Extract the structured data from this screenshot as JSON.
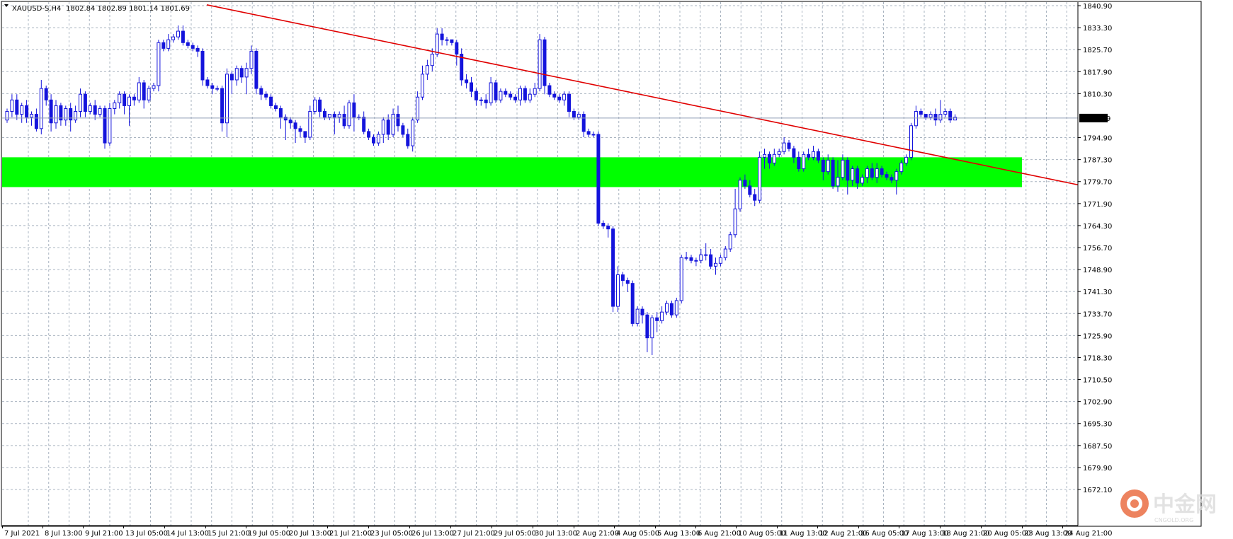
{
  "header": {
    "symbol": "XAUUSD-S,H4",
    "ohlc": "1802.84 1802.89 1801.14 1801.69"
  },
  "colors": {
    "background": "#ffffff",
    "grid": "#a9b4c0",
    "bull": "#1414dc",
    "bear": "#1414dc",
    "zone": "#00ff00",
    "trendline": "#e00000",
    "price_line": "#8f9cb4",
    "price_tag_bg": "#000000",
    "price_tag_text": "#ffffff"
  },
  "watermark": {
    "brand": "中金网",
    "sub": "CNGOLD.ORG"
  },
  "chart_data": {
    "type": "candlestick",
    "symbol": "XAUUSD-S",
    "timeframe": "H4",
    "current_price": 1801.69,
    "y_range": [
      1672.1,
      1840.9
    ],
    "y_ticks": [
      "1840.90",
      "1833.30",
      "1825.70",
      "1817.90",
      "1810.30",
      "1801.69",
      "1794.90",
      "1787.30",
      "1779.70",
      "1771.90",
      "1764.30",
      "1756.70",
      "1748.90",
      "1741.30",
      "1733.70",
      "1725.90",
      "1718.30",
      "1710.50",
      "1702.90",
      "1695.30",
      "1687.50",
      "1679.90",
      "1672.10"
    ],
    "x_ticks": [
      "7 Jul 2021",
      "8 Jul 13:00",
      "9 Jul 21:00",
      "13 Jul 05:00",
      "14 Jul 13:00",
      "15 Jul 21:00",
      "19 Jul 05:00",
      "20 Jul 13:00",
      "21 Jul 21:00",
      "23 Jul 05:00",
      "26 Jul 13:00",
      "27 Jul 21:00",
      "29 Jul 05:00",
      "30 Jul 13:00",
      "2 Aug 21:00",
      "4 Aug 05:00",
      "5 Aug 13:00",
      "6 Aug 21:00",
      "10 Aug 05:00",
      "11 Aug 13:00",
      "12 Aug 21:00",
      "16 Aug 05:00",
      "17 Aug 13:00",
      "18 Aug 21:00",
      "20 Aug 05:00",
      "23 Aug 13:00",
      "24 Aug 21:00"
    ],
    "support_zone": [
      1777.6,
      1788.0
    ],
    "trendline": {
      "from": [
        0,
        1841.2
      ],
      "to": [
        261,
        1778.4
      ]
    },
    "candles": [
      [
        1801,
        1804,
        1800,
        1805
      ],
      [
        1804,
        1808,
        1802,
        1810
      ],
      [
        1808,
        1803,
        1801,
        1810
      ],
      [
        1803,
        1806,
        1800,
        1807
      ],
      [
        1806,
        1802,
        1800,
        1808
      ],
      [
        1802,
        1803,
        1799,
        1804
      ],
      [
        1803,
        1798,
        1797,
        1805
      ],
      [
        1798,
        1812,
        1796,
        1815
      ],
      [
        1812,
        1808,
        1806,
        1813
      ],
      [
        1808,
        1800,
        1797,
        1810
      ],
      [
        1800,
        1806,
        1798,
        1808
      ],
      [
        1806,
        1801,
        1799,
        1807
      ],
      [
        1801,
        1805,
        1799,
        1806
      ],
      [
        1805,
        1801,
        1797,
        1807
      ],
      [
        1801,
        1804,
        1800,
        1806
      ],
      [
        1804,
        1810,
        1802,
        1812
      ],
      [
        1810,
        1804,
        1802,
        1811
      ],
      [
        1804,
        1806,
        1803,
        1807
      ],
      [
        1806,
        1803,
        1801,
        1808
      ],
      [
        1803,
        1805,
        1802,
        1806
      ],
      [
        1805,
        1793,
        1791,
        1806
      ],
      [
        1793,
        1805,
        1792,
        1807
      ],
      [
        1805,
        1807,
        1803,
        1808
      ],
      [
        1807,
        1810,
        1805,
        1811
      ],
      [
        1810,
        1806,
        1803,
        1811
      ],
      [
        1806,
        1809,
        1799,
        1810
      ],
      [
        1809,
        1808,
        1806,
        1810
      ],
      [
        1808,
        1814,
        1807,
        1816
      ],
      [
        1814,
        1808,
        1805,
        1815
      ],
      [
        1808,
        1812,
        1807,
        1813
      ],
      [
        1812,
        1813,
        1811,
        1814
      ],
      [
        1813,
        1828,
        1811,
        1829
      ],
      [
        1828,
        1826,
        1825,
        1829
      ],
      [
        1826,
        1829,
        1825,
        1831
      ],
      [
        1829,
        1830,
        1828,
        1831
      ],
      [
        1830,
        1832,
        1829,
        1834
      ],
      [
        1832,
        1828,
        1827,
        1834
      ],
      [
        1828,
        1827,
        1826,
        1829
      ],
      [
        1827,
        1826,
        1825,
        1828
      ],
      [
        1826,
        1825,
        1823,
        1827
      ],
      [
        1825,
        1815,
        1813,
        1826
      ],
      [
        1815,
        1813,
        1812,
        1816
      ],
      [
        1813,
        1812,
        1810,
        1814
      ],
      [
        1812,
        1812,
        1811,
        1813
      ],
      [
        1812,
        1800,
        1797,
        1813
      ],
      [
        1800,
        1817,
        1795,
        1819
      ],
      [
        1817,
        1815,
        1810,
        1818
      ],
      [
        1815,
        1819,
        1813,
        1820
      ],
      [
        1819,
        1816,
        1814,
        1820
      ],
      [
        1816,
        1819,
        1810,
        1821
      ],
      [
        1819,
        1825,
        1817,
        1827
      ],
      [
        1825,
        1812,
        1810,
        1826
      ],
      [
        1812,
        1810,
        1808,
        1813
      ],
      [
        1810,
        1809,
        1808,
        1811
      ],
      [
        1809,
        1806,
        1805,
        1810
      ],
      [
        1806,
        1805,
        1804,
        1807
      ],
      [
        1805,
        1802,
        1798,
        1806
      ],
      [
        1802,
        1801,
        1794,
        1803
      ],
      [
        1801,
        1800,
        1798,
        1802
      ],
      [
        1800,
        1798,
        1793,
        1801
      ],
      [
        1798,
        1797,
        1795,
        1799
      ],
      [
        1797,
        1795,
        1793,
        1797
      ],
      [
        1795,
        1804,
        1794,
        1806
      ],
      [
        1804,
        1808,
        1803,
        1809
      ],
      [
        1808,
        1804,
        1802,
        1809
      ],
      [
        1804,
        1802,
        1801,
        1805
      ],
      [
        1802,
        1803,
        1801,
        1803
      ],
      [
        1803,
        1802,
        1796,
        1804
      ],
      [
        1802,
        1803,
        1800,
        1804
      ],
      [
        1803,
        1799,
        1798,
        1806
      ],
      [
        1799,
        1807,
        1798,
        1808
      ],
      [
        1807,
        1802,
        1797,
        1810
      ],
      [
        1802,
        1802,
        1801,
        1803
      ],
      [
        1802,
        1797,
        1796,
        1804
      ],
      [
        1797,
        1795,
        1794,
        1798
      ],
      [
        1795,
        1793,
        1792,
        1796
      ],
      [
        1793,
        1796,
        1792,
        1797
      ],
      [
        1796,
        1801,
        1793,
        1802
      ],
      [
        1801,
        1796,
        1794,
        1803
      ],
      [
        1796,
        1803,
        1795,
        1805
      ],
      [
        1803,
        1799,
        1797,
        1806
      ],
      [
        1799,
        1796,
        1795,
        1800
      ],
      [
        1796,
        1792,
        1791,
        1798
      ],
      [
        1792,
        1801,
        1790,
        1802
      ],
      [
        1801,
        1809,
        1800,
        1811
      ],
      [
        1809,
        1817,
        1808,
        1820
      ],
      [
        1817,
        1820,
        1815,
        1822
      ],
      [
        1820,
        1824,
        1818,
        1826
      ],
      [
        1824,
        1831,
        1823,
        1833
      ],
      [
        1831,
        1829,
        1827,
        1833
      ],
      [
        1829,
        1829,
        1827,
        1830
      ],
      [
        1829,
        1828,
        1827,
        1829
      ],
      [
        1828,
        1824,
        1820,
        1829
      ],
      [
        1824,
        1815,
        1813,
        1826
      ],
      [
        1815,
        1814,
        1812,
        1817
      ],
      [
        1814,
        1811,
        1809,
        1816
      ],
      [
        1811,
        1808,
        1806,
        1812
      ],
      [
        1808,
        1808,
        1806,
        1809
      ],
      [
        1808,
        1807,
        1805,
        1810
      ],
      [
        1807,
        1814,
        1806,
        1816
      ],
      [
        1814,
        1808,
        1807,
        1815
      ],
      [
        1808,
        1811,
        1807,
        1812
      ],
      [
        1811,
        1810,
        1809,
        1812
      ],
      [
        1810,
        1809,
        1808,
        1811
      ],
      [
        1809,
        1808,
        1807,
        1810
      ],
      [
        1808,
        1812,
        1806,
        1813
      ],
      [
        1812,
        1808,
        1807,
        1813
      ],
      [
        1808,
        1810,
        1807,
        1812
      ],
      [
        1810,
        1812,
        1809,
        1814
      ],
      [
        1812,
        1829,
        1811,
        1831
      ],
      [
        1829,
        1813,
        1810,
        1830
      ],
      [
        1813,
        1810,
        1809,
        1814
      ],
      [
        1810,
        1809,
        1808,
        1811
      ],
      [
        1809,
        1808,
        1807,
        1810
      ],
      [
        1808,
        1810,
        1806,
        1811
      ],
      [
        1810,
        1804,
        1802,
        1811
      ],
      [
        1804,
        1802,
        1801,
        1805
      ],
      [
        1802,
        1803,
        1801,
        1804
      ],
      [
        1803,
        1797,
        1795,
        1804
      ],
      [
        1797,
        1796,
        1795,
        1798
      ],
      [
        1796,
        1796,
        1795,
        1797
      ],
      [
        1796,
        1765,
        1764,
        1797
      ],
      [
        1765,
        1764,
        1763,
        1766
      ],
      [
        1764,
        1763,
        1760,
        1765
      ],
      [
        1763,
        1736,
        1734,
        1764
      ],
      [
        1736,
        1747,
        1734,
        1750
      ],
      [
        1747,
        1745,
        1743,
        1748
      ],
      [
        1745,
        1744,
        1741,
        1746
      ],
      [
        1744,
        1730,
        1729,
        1745
      ],
      [
        1730,
        1735,
        1729,
        1736
      ],
      [
        1735,
        1733,
        1730,
        1736
      ],
      [
        1733,
        1725,
        1720,
        1734
      ],
      [
        1725,
        1732,
        1719,
        1733
      ],
      [
        1732,
        1731,
        1727,
        1734
      ],
      [
        1731,
        1734,
        1730,
        1736
      ],
      [
        1734,
        1737,
        1733,
        1738
      ],
      [
        1737,
        1733,
        1732,
        1738
      ],
      [
        1733,
        1738,
        1732,
        1739
      ],
      [
        1738,
        1753,
        1737,
        1754
      ],
      [
        1753,
        1753,
        1752,
        1755
      ],
      [
        1753,
        1752,
        1751,
        1754
      ],
      [
        1752,
        1752,
        1750,
        1753
      ],
      [
        1752,
        1754,
        1751,
        1756
      ],
      [
        1754,
        1754,
        1752,
        1758
      ],
      [
        1754,
        1750,
        1749,
        1756
      ],
      [
        1750,
        1751,
        1747,
        1753
      ],
      [
        1751,
        1753,
        1750,
        1754
      ],
      [
        1753,
        1756,
        1752,
        1757
      ],
      [
        1756,
        1761,
        1755,
        1762
      ],
      [
        1761,
        1770,
        1760,
        1777
      ],
      [
        1770,
        1780,
        1769,
        1781
      ],
      [
        1780,
        1778,
        1777,
        1782
      ],
      [
        1778,
        1775,
        1774,
        1780
      ],
      [
        1775,
        1773,
        1771,
        1777
      ],
      [
        1773,
        1788,
        1772,
        1790
      ],
      [
        1788,
        1789,
        1784,
        1791
      ],
      [
        1789,
        1786,
        1784,
        1790
      ],
      [
        1786,
        1789,
        1785,
        1791
      ],
      [
        1789,
        1790,
        1788,
        1791
      ],
      [
        1790,
        1793,
        1789,
        1795
      ],
      [
        1793,
        1791,
        1790,
        1794
      ],
      [
        1791,
        1788,
        1786,
        1792
      ],
      [
        1788,
        1784,
        1783,
        1790
      ],
      [
        1784,
        1789,
        1783,
        1790
      ],
      [
        1789,
        1788,
        1787,
        1791
      ],
      [
        1788,
        1790,
        1787,
        1792
      ],
      [
        1790,
        1787,
        1786,
        1791
      ],
      [
        1787,
        1783,
        1780,
        1788
      ],
      [
        1783,
        1787,
        1782,
        1789
      ],
      [
        1787,
        1778,
        1777,
        1788
      ],
      [
        1778,
        1781,
        1776,
        1787
      ],
      [
        1781,
        1787,
        1780,
        1789
      ],
      [
        1787,
        1780,
        1775,
        1788
      ],
      [
        1780,
        1784,
        1778,
        1785
      ],
      [
        1784,
        1779,
        1777,
        1785
      ],
      [
        1779,
        1781,
        1778,
        1782
      ],
      [
        1781,
        1784,
        1779,
        1785
      ],
      [
        1784,
        1781,
        1780,
        1786
      ],
      [
        1781,
        1784,
        1779,
        1786
      ],
      [
        1784,
        1782,
        1781,
        1785
      ],
      [
        1782,
        1781,
        1780,
        1783
      ],
      [
        1781,
        1780,
        1779,
        1782
      ],
      [
        1780,
        1783,
        1775,
        1784
      ],
      [
        1783,
        1786,
        1782,
        1787
      ],
      [
        1786,
        1788,
        1785,
        1789
      ],
      [
        1788,
        1799,
        1787,
        1800
      ],
      [
        1799,
        1804,
        1798,
        1806
      ],
      [
        1804,
        1803,
        1802,
        1805
      ],
      [
        1803,
        1802,
        1801,
        1803
      ],
      [
        1802,
        1803,
        1801,
        1804
      ],
      [
        1803,
        1801,
        1799,
        1805
      ],
      [
        1801,
        1803,
        1800,
        1808
      ],
      [
        1803,
        1804,
        1802,
        1805
      ],
      [
        1804,
        1801,
        1800,
        1805
      ],
      [
        1801,
        1802,
        1801,
        1803
      ]
    ]
  }
}
